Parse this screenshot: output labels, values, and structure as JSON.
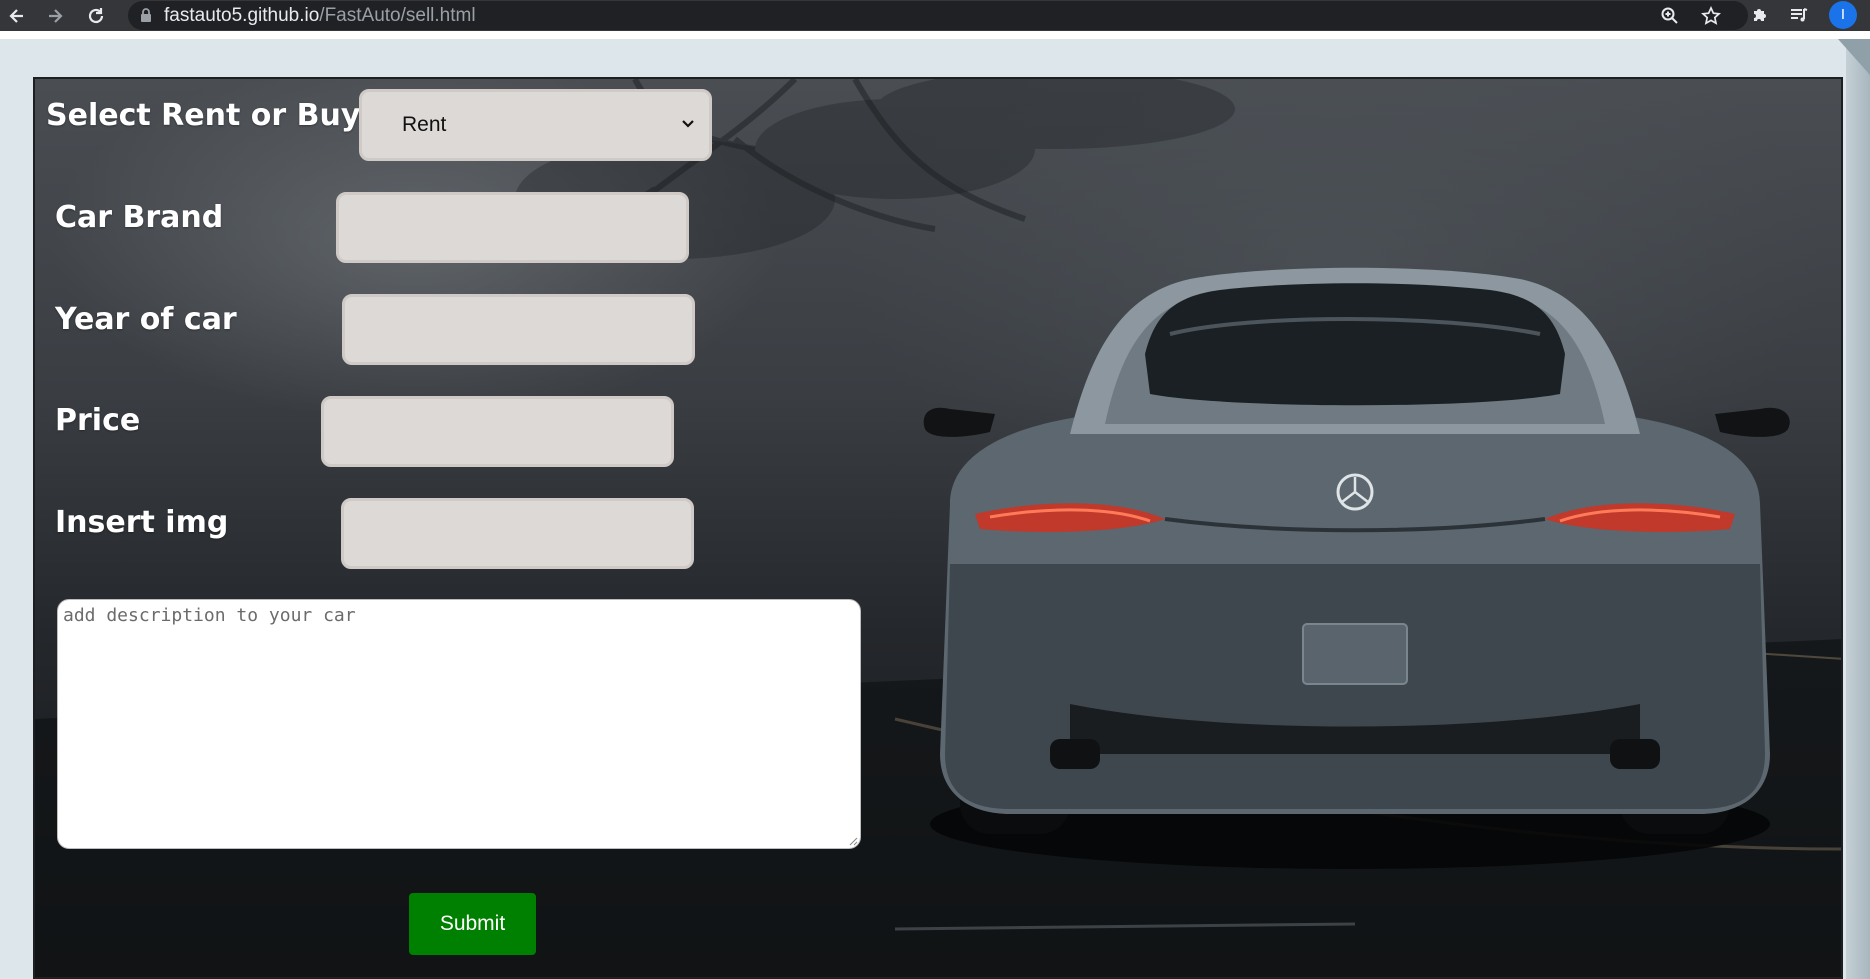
{
  "browser": {
    "url_host": "fastauto5.github.io",
    "url_path": "/FastAuto/sell.html",
    "profile_initial": "I"
  },
  "form": {
    "type_label": "Select Rent or Buy",
    "type_selected": "Rent",
    "brand_label": "Car Brand",
    "brand_value": "",
    "year_label": "Year of car",
    "year_value": "",
    "price_label": "Price",
    "price_value": "",
    "img_label": "Insert img",
    "img_value": "",
    "description_placeholder": "add description to your car",
    "submit_label": "Submit"
  },
  "colors": {
    "submit_bg": "#008000",
    "field_bg": "#ddd9d6",
    "chrome_bg": "#35363a",
    "profile_bg": "#1a73e8"
  },
  "icons": [
    "back-arrow-icon",
    "forward-arrow-icon",
    "reload-icon",
    "lock-icon",
    "zoom-icon",
    "star-icon",
    "extensions-puzzle-icon",
    "reading-list-icon",
    "chevron-down-icon"
  ]
}
